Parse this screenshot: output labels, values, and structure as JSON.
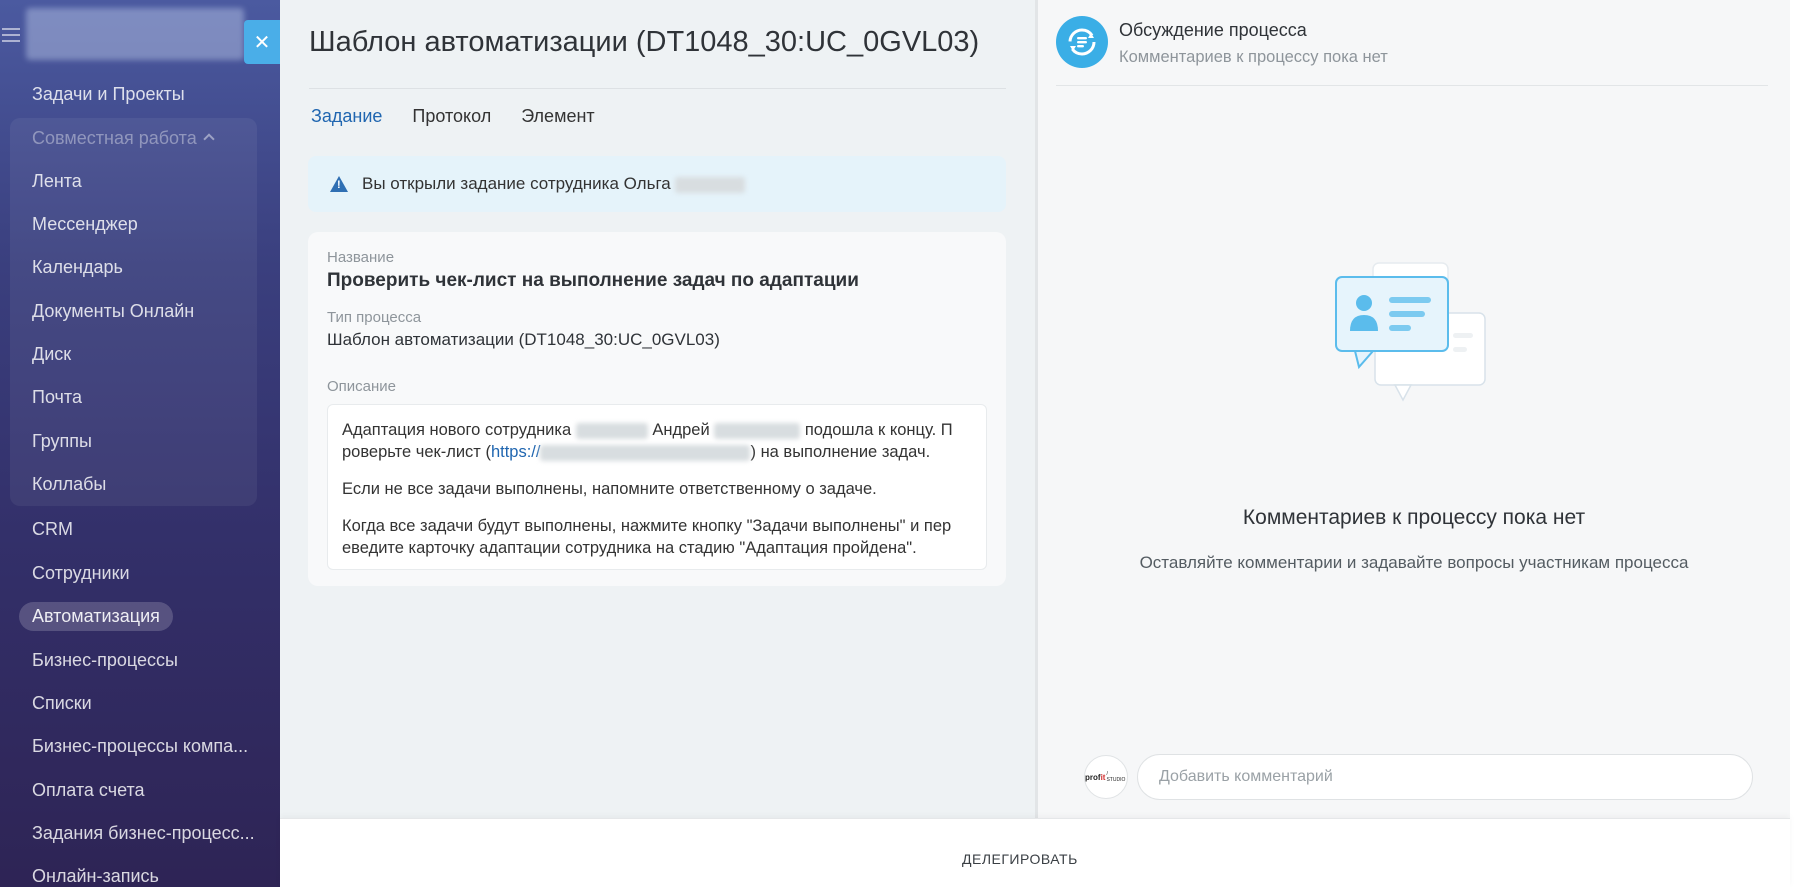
{
  "sidebar": {
    "items": [
      {
        "label": "Задачи и Проекты"
      },
      {
        "label": "Совместная работа"
      },
      {
        "label": "Лента"
      },
      {
        "label": "Мессенджер"
      },
      {
        "label": "Календарь"
      },
      {
        "label": "Документы Онлайн"
      },
      {
        "label": "Диск"
      },
      {
        "label": "Почта"
      },
      {
        "label": "Группы"
      },
      {
        "label": "Коллабы"
      },
      {
        "label": "CRM"
      },
      {
        "label": "Сотрудники"
      },
      {
        "label": "Автоматизация"
      },
      {
        "label": "Бизнес-процессы"
      },
      {
        "label": "Списки"
      },
      {
        "label": "Бизнес-процессы компа..."
      },
      {
        "label": "Оплата счета"
      },
      {
        "label": "Задания бизнес-процесс..."
      },
      {
        "label": "Онлайн-запись"
      }
    ]
  },
  "task": {
    "title": "Шаблон автоматизации (DT1048_30:UC_0GVL03)",
    "tabs": [
      {
        "label": "Задание"
      },
      {
        "label": "Протокол"
      },
      {
        "label": "Элемент"
      }
    ],
    "alert_text": "Вы открыли задание сотрудника Ольга",
    "fields": {
      "name_label": "Название",
      "name_value": "Проверить чек-лист на выполнение задач по адаптации",
      "type_label": "Тип процесса",
      "type_value": "Шаблон автоматизации (DT1048_30:UC_0GVL03)",
      "description_label": "Описание"
    },
    "description": {
      "p1_a": "Адаптация нового сотрудника",
      "p1_b": "Андрей",
      "p1_c": "подошла к концу. П",
      "p1_d": "роверьте чек-лист (",
      "p1_link": "https://",
      "p1_e": ") на выполнение задач.",
      "p2": "Если не все задачи выполнены, напомните ответственному о задаче.",
      "p3": "Когда все задачи будут выполнены, нажмите кнопку \"Задачи выполнены\" и пер еведите карточку адаптации сотрудника на стадию \"Адаптация пройдена\"."
    }
  },
  "discussion": {
    "title": "Обсуждение процесса",
    "subtitle": "Комментариев к процессу пока нет",
    "empty_title": "Комментариев к процессу пока нет",
    "empty_subtitle": "Оставляйте комментарии и задавайте вопросы участникам процесса",
    "comment_placeholder": "Добавить комментарий",
    "avatar_text_a": "prof",
    "avatar_text_b": "it",
    "avatar_text_c": "/ STUDIO"
  },
  "footer": {
    "delegate_label": "ДЕЛЕГИРОВАТЬ"
  },
  "colors": {
    "accent": "#2066b0",
    "brand_blue": "#3aaee6"
  },
  "icons": {
    "menu": "hamburger-icon",
    "close": "close-icon",
    "warning": "warning-icon",
    "process": "process-discussion-icon"
  }
}
